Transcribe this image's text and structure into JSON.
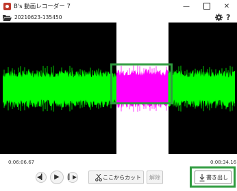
{
  "window": {
    "title": "B's 動画レコーダー 7",
    "minimize_icon": "minimize-icon",
    "maximize_icon": "maximize-icon",
    "close_icon": "close-icon"
  },
  "toolbar": {
    "file_name": "20210623-135450",
    "open_icon": "folder-icon",
    "settings_icon": "gear-icon",
    "help_label": "?"
  },
  "timeline": {
    "start_time": "0:06:06.67",
    "end_time": "0:08:34.16"
  },
  "controls": {
    "prev_icon": "skip-back-icon",
    "play_icon": "play-icon",
    "next_icon": "skip-forward-icon",
    "cut_label": "ここからカット",
    "unlock_label": "解除",
    "export_label": "書き出し"
  },
  "colors": {
    "wave_unselected": "#00ff00",
    "wave_selected": "#ff00ff",
    "background": "#000000",
    "selection_band": "#ffffff",
    "highlight": "#2e9b3e"
  }
}
